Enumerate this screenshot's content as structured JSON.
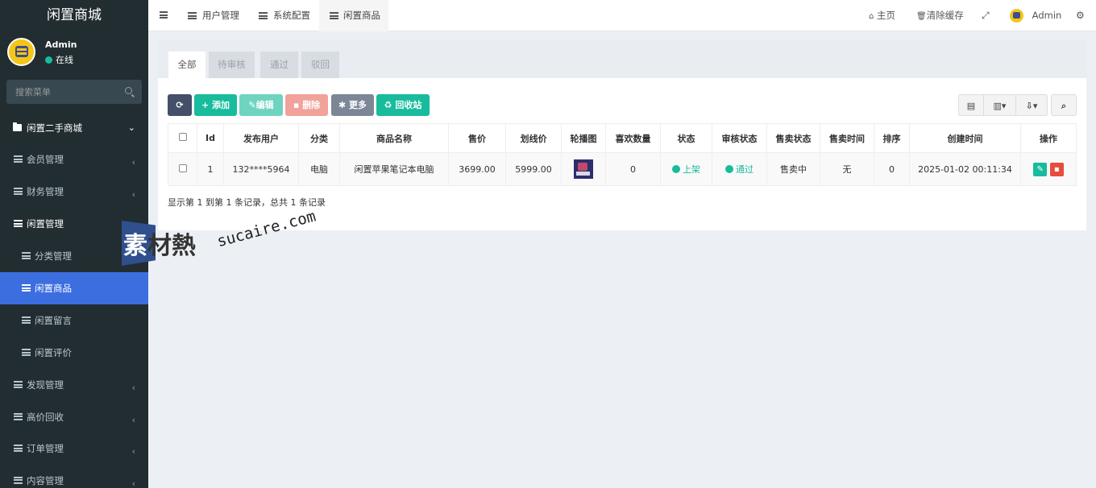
{
  "app": {
    "title": "闲置商城"
  },
  "user": {
    "name": "Admin",
    "status": "在线"
  },
  "sidebar": {
    "search_placeholder": "搜索菜单",
    "items": [
      {
        "label": "闲置二手商城",
        "icon": "folder-icon",
        "level": "top",
        "chevron": "⌄"
      },
      {
        "label": "会员管理",
        "icon": "list-icon",
        "level": "top",
        "chevron": "‹"
      },
      {
        "label": "财务管理",
        "icon": "list-icon",
        "level": "top",
        "chevron": "‹"
      },
      {
        "label": "闲置管理",
        "icon": "list-icon",
        "level": "top",
        "chevron": ""
      },
      {
        "label": "分类管理",
        "icon": "list-icon",
        "level": "sub",
        "chevron": ""
      },
      {
        "label": "闲置商品",
        "icon": "list-icon",
        "level": "sub",
        "chevron": "",
        "active": true
      },
      {
        "label": "闲置留言",
        "icon": "list-icon",
        "level": "sub",
        "chevron": ""
      },
      {
        "label": "闲置评价",
        "icon": "list-icon",
        "level": "sub",
        "chevron": ""
      },
      {
        "label": "发现管理",
        "icon": "list-icon",
        "level": "top",
        "chevron": "‹"
      },
      {
        "label": "高价回收",
        "icon": "list-icon",
        "level": "top",
        "chevron": "‹"
      },
      {
        "label": "订单管理",
        "icon": "list-icon",
        "level": "top",
        "chevron": "‹"
      },
      {
        "label": "内容管理",
        "icon": "list-icon",
        "level": "top",
        "chevron": "‹"
      }
    ]
  },
  "navbar": {
    "tabs": [
      "用户管理",
      "系统配置",
      "闲置商品"
    ],
    "home": "主页",
    "clear_cache": "清除缓存",
    "admin": "Admin"
  },
  "content": {
    "tabs": [
      "全部",
      "待审核",
      "通过",
      "驳回"
    ],
    "toolbar": {
      "add": "添加",
      "edit": "编辑",
      "delete": "删除",
      "more": "更多",
      "recycle": "回收站"
    },
    "columns": [
      "Id",
      "发布用户",
      "分类",
      "商品名称",
      "售价",
      "划线价",
      "轮播图",
      "喜欢数量",
      "状态",
      "审核状态",
      "售卖状态",
      "售卖时间",
      "排序",
      "创建时间",
      "操作"
    ],
    "rows": [
      {
        "id": "1",
        "user": "132****5964",
        "category": "电脑",
        "name": "闲置苹果笔记本电脑",
        "price": "3699.00",
        "original_price": "5999.00",
        "likes": "0",
        "status": "上架",
        "audit": "通过",
        "sale_status": "售卖中",
        "sale_time": "无",
        "sort": "0",
        "created": "2025-01-02 00:11:34"
      }
    ],
    "pager": "显示第 1 到第 1 条记录，总共 1 条记录"
  },
  "watermark": {
    "cn": "素材熱",
    "url": "sucaire.com"
  },
  "colors": {
    "sidebar_bg": "#222d32",
    "active": "#3c6ee0",
    "success": "#18bc9c",
    "danger": "#e74c3c"
  }
}
